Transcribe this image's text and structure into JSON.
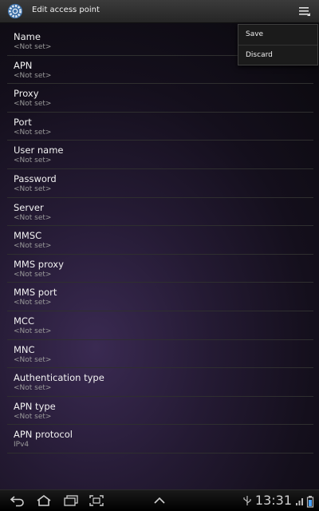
{
  "header": {
    "title": "Edit access point",
    "app_icon": "settings-gear-icon",
    "menu_icon": "overflow-menu-icon"
  },
  "menu": {
    "items": [
      {
        "label": "Save"
      },
      {
        "label": "Discard"
      }
    ]
  },
  "fields": [
    {
      "label": "Name",
      "value": "<Not set>"
    },
    {
      "label": "APN",
      "value": "<Not set>"
    },
    {
      "label": "Proxy",
      "value": "<Not set>"
    },
    {
      "label": "Port",
      "value": "<Not set>"
    },
    {
      "label": "User name",
      "value": "<Not set>"
    },
    {
      "label": "Password",
      "value": "<Not set>"
    },
    {
      "label": "Server",
      "value": "<Not set>"
    },
    {
      "label": "MMSC",
      "value": "<Not set>"
    },
    {
      "label": "MMS proxy",
      "value": "<Not set>"
    },
    {
      "label": "MMS port",
      "value": "<Not set>"
    },
    {
      "label": "MCC",
      "value": "<Not set>"
    },
    {
      "label": "MNC",
      "value": "<Not set>"
    },
    {
      "label": "Authentication type",
      "value": "<Not set>"
    },
    {
      "label": "APN type",
      "value": "<Not set>"
    },
    {
      "label": "APN protocol",
      "value": "IPv4"
    }
  ],
  "statusbar": {
    "time": "13:31",
    "icons": [
      "back-icon",
      "home-icon",
      "recent-apps-icon",
      "screenshot-icon",
      "up-arrow-icon",
      "usb-icon",
      "signal-icon",
      "battery-icon"
    ]
  }
}
